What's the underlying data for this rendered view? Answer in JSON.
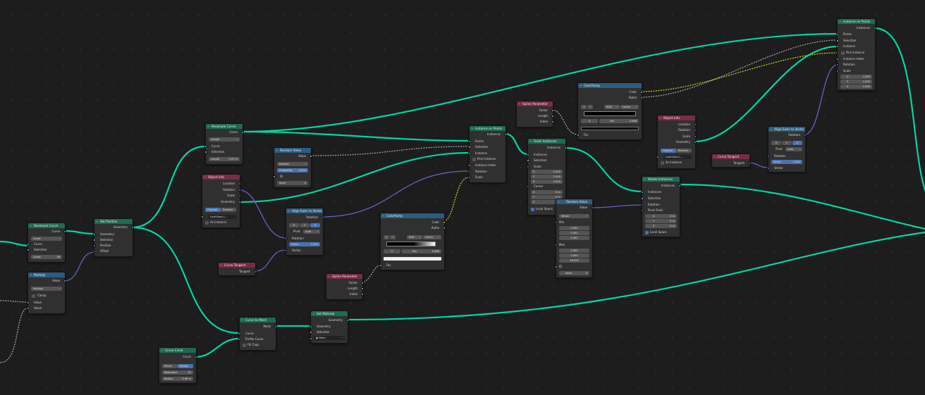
{
  "colors": {
    "geometry_header": "#1b6b55",
    "input_header": "#7a2b44",
    "converter_header": "#2a5d80",
    "link_geometry": "#00d6a3",
    "link_vector": "#6363c7",
    "link_float": "#a1a1a1",
    "link_color": "#c7c729"
  },
  "nodes": {
    "resample_left": {
      "title": "Resample Curve",
      "out_curve": "Curve",
      "mode": "Count",
      "in_curve": "Curve",
      "in_selection": "Selection",
      "count_label": "Count",
      "count_value": "36"
    },
    "multiply": {
      "title": "Multiply",
      "out_value": "Value",
      "op": "Multiply",
      "clamp": "Clamp",
      "in_value1": "Value",
      "in_value2": "Value"
    },
    "set_position": {
      "title": "Set Position",
      "out_geo": "Geometry",
      "in_geo": "Geometry",
      "in_sel": "Selection",
      "in_pos": "Position",
      "in_offset": "Offset"
    },
    "resample_mid": {
      "title": "Resample Curve",
      "out_curve": "Curve",
      "mode": "Length",
      "in_curve": "Curve",
      "in_selection": "Selection",
      "len_label": "Length",
      "len_value": "0.07 m"
    },
    "objinfo_left": {
      "title": "Object Info",
      "out_loc": "Location",
      "out_rot": "Rotation",
      "out_scale": "Scale",
      "out_geo": "Geometry",
      "btn_original": "Original",
      "btn_relative": "Relative",
      "obj": "LushVious L...",
      "as_instance": "As Instance"
    },
    "random_value": {
      "title": "Random Value",
      "out_value": "Value",
      "mode": "Boolean",
      "prob_label": "Probability",
      "prob_value": "0.900",
      "in_id": "ID",
      "seed_label": "Seed",
      "seed_value": "5"
    },
    "align_left": {
      "title": "Align Euler to Vector",
      "out_rot": "Rotation",
      "x": "X",
      "y": "Y",
      "z": "Z",
      "pivot_label": "Pivot",
      "pivot_value": "Auto",
      "in_rot": "Rotation",
      "factor_label": "Factor",
      "factor_value": "1.000",
      "in_vec": "Vector"
    },
    "curve_tangent_left": {
      "title": "Curve Tangent",
      "out_tangent": "Tangent"
    },
    "colorramp_mid": {
      "title": "ColorRamp",
      "out_color": "Color",
      "out_alpha": "Alpha",
      "mode": "RGB",
      "interp": "Linear",
      "idx": "0",
      "pos_label": "Pos",
      "pos_value": "0.486",
      "in_fac": "Fac"
    },
    "spline_param_mid": {
      "title": "Spline Parameter",
      "out_factor": "Factor",
      "out_length": "Length",
      "out_index": "Index"
    },
    "curve_to_mesh": {
      "title": "Curve to Mesh",
      "out_mesh": "Mesh",
      "in_curve": "Curve",
      "in_profile": "Profile Curve",
      "fill_caps": "Fill Caps"
    },
    "curve_circle": {
      "title": "Curve Circle",
      "out_curve": "Curve",
      "btn_points": "Points",
      "btn_radius": "Radius",
      "res_label": "Resolution",
      "res_value": "32",
      "rad_label": "Radius",
      "rad_value": "0.08 m"
    },
    "set_material": {
      "title": "Set Material",
      "out_geo": "Geometry",
      "in_geo": "Geometry",
      "in_sel": "Selection",
      "mat": "Stem"
    },
    "instance_mid": {
      "title": "Instance on Points",
      "out_inst": "Instances",
      "in_points": "Points",
      "in_sel": "Selection",
      "in_inst": "Instance",
      "pick": "Pick Instance",
      "inst_index": "Instance Index",
      "in_rot": "Rotation",
      "in_scale": "Scale"
    },
    "spline_param_top": {
      "title": "Spline Parameter",
      "out_factor": "Factor",
      "out_length": "Length",
      "out_index": "Index"
    },
    "colorramp_top": {
      "title": "ColorRamp",
      "out_color": "Color",
      "out_alpha": "Alpha",
      "mode": "RGB",
      "interp": "Linear",
      "idx": "0",
      "pos_label": "Pos",
      "pos_value": "0.986",
      "in_fac": "Fac"
    },
    "scale_instances": {
      "title": "Scale Instances",
      "out_inst": "Instances",
      "in_inst": "Instances",
      "in_sel": "Selection",
      "scale_label": "Scale",
      "sx": "X",
      "sx_v": "2.300",
      "sy": "Y",
      "sy_v": "1.000",
      "sz": "Z",
      "sz_v": "1.000",
      "center_label": "Center",
      "cx": "X",
      "cx_v": "0 m",
      "cy": "Y",
      "cy_v": "0 m",
      "cz": "Z",
      "cz_v": "0 m",
      "local": "Local Space"
    },
    "random_vec": {
      "title": "Random Value",
      "out_value": "Value",
      "mode": "Vector",
      "min_label": "Min",
      "min1": "0.000",
      "min2": "0.000",
      "min3": "0.000",
      "max_label": "Max",
      "max1": "0.000",
      "max2": "0.000",
      "max3": "38.000",
      "in_id": "ID",
      "seed_label": "Seed",
      "seed_value": "0"
    },
    "rotate_instances": {
      "title": "Rotate Instances",
      "out_inst": "Instances",
      "in_inst": "Instances",
      "in_sel": "Selection",
      "in_rot": "Rotation",
      "pivot_label": "Pivot Point",
      "px": "X",
      "px_v": "0 m",
      "py": "Y",
      "py_v": "0 m",
      "pz": "Z",
      "pz_v": "0 m",
      "local": "Local Space"
    },
    "objinfo_right": {
      "title": "Object Info",
      "out_loc": "Location",
      "out_rot": "Rotation",
      "out_scale": "Scale",
      "out_geo": "Geometry",
      "btn_original": "Original",
      "btn_relative": "Relative",
      "obj": "LushVious L...",
      "as_instance": "As Instance"
    },
    "curve_tangent_right": {
      "title": "Curve Tangent",
      "out_tangent": "Tangent"
    },
    "align_right": {
      "title": "Align Euler to Vector",
      "out_rot": "Rotation",
      "x": "X",
      "y": "Y",
      "z": "Z",
      "pivot_label": "Pivot",
      "pivot_value": "Auto",
      "in_rot": "Rotation",
      "factor_label": "Factor",
      "factor_value": "1.000",
      "in_vec": "Vector"
    },
    "instance_top": {
      "title": "Instance on Points",
      "out_inst": "Instances",
      "in_points": "Points",
      "in_sel": "Selection",
      "in_inst": "Instance",
      "pick": "Pick Instance",
      "inst_index": "Instance Index",
      "in_rot": "Rotation",
      "in_scale": "Scale",
      "sx": "X",
      "sx_v": "1.000",
      "sy": "Y",
      "sy_v": "1.000",
      "sz": "Z",
      "sz_v": "1.000"
    }
  }
}
